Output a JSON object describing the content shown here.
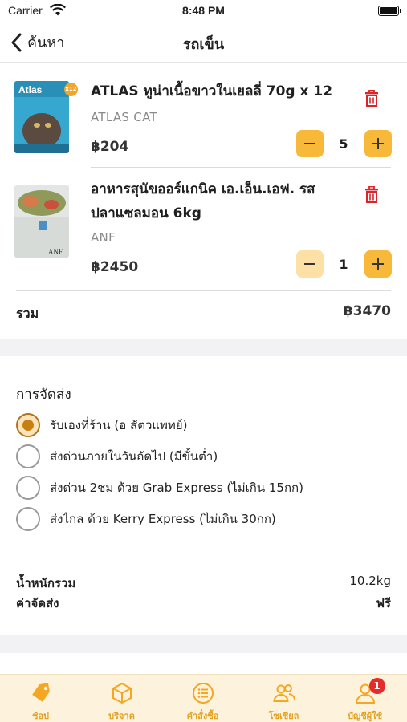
{
  "status_bar": {
    "carrier": "Carrier",
    "time": "8:48 PM"
  },
  "nav": {
    "back_label": "ค้นหา",
    "title": "รถเข็น"
  },
  "cart": {
    "items": [
      {
        "name": "ATLAS ทูน่าเนื้อขาวในเยลลี่ 70g x 12",
        "brand": "ATLAS CAT",
        "price": "฿204",
        "quantity": "5",
        "image_text": "Atlas",
        "image_badge": "x12"
      },
      {
        "name": "อาหารสุนัขออร์แกนิค เอ.เอ็น.เอฟ. รส ปลาแซลมอน 6kg",
        "brand": "ANF",
        "price": "฿2450",
        "quantity": "1",
        "image_text": "ANF"
      }
    ],
    "total_label": "รวม",
    "total_value": "฿3470"
  },
  "shipping": {
    "title": "การจัดส่ง",
    "options": [
      {
        "label": "รับเองที่ร้าน (อ สัตวแพทย์)",
        "selected": true
      },
      {
        "label": "ส่งด่วนภายในวันถัดไป (มีขั้นต่ำ)",
        "selected": false
      },
      {
        "label": "ส่งด่วน 2ชม ด้วย Grab Express (ไม่เกิน 15กก)",
        "selected": false
      },
      {
        "label": "ส่งไกล ด้วย Kerry Express (ไม่เกิน 30กก)",
        "selected": false
      }
    ],
    "weight_label": "น้ำหนักรวม",
    "weight_value": "10.2kg",
    "fee_label": "ค่าจัดส่ง",
    "fee_value": "ฟรี"
  },
  "tab_bar": {
    "tabs": [
      {
        "label": "ช้อป",
        "icon": "tag-icon"
      },
      {
        "label": "บริจาค",
        "icon": "box-icon"
      },
      {
        "label": "คำสั่งซื้อ",
        "icon": "list-icon"
      },
      {
        "label": "โซเชียล",
        "icon": "people-icon"
      },
      {
        "label": "บัญชีผู้ใช้",
        "icon": "user-icon",
        "badge": "1"
      }
    ]
  },
  "colors": {
    "accent": "#f8b93a",
    "accent_light": "#fde0a6",
    "tab_text": "#e3a11f",
    "trash": "#d9252a",
    "radio_selected": "#c57f12",
    "badge": "#e52b2b"
  }
}
